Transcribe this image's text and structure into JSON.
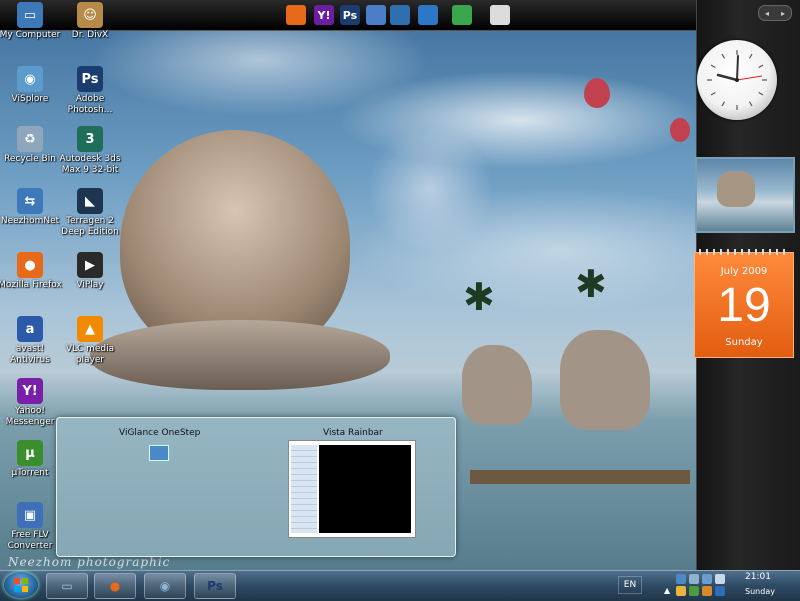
{
  "quick_launch": [
    {
      "name": "firefox-icon",
      "glyph": "",
      "color": "#e66a1a"
    },
    {
      "name": "yahoo-messenger-icon",
      "glyph": "Y!",
      "color": "#6b1fa0"
    },
    {
      "name": "photoshop-icon",
      "glyph": "Ps",
      "color": "#1b3c6e"
    },
    {
      "name": "finder-icon",
      "glyph": "",
      "color": "#4b7dc8"
    },
    {
      "name": "monitor-icon",
      "glyph": "",
      "color": "#2f6fb0"
    },
    {
      "name": "lightning-icon",
      "glyph": "",
      "color": "#2c78c6"
    },
    {
      "name": "recycle-icon",
      "glyph": "",
      "color": "#3aa64b"
    },
    {
      "name": "apple-icon",
      "glyph": "",
      "color": "#dcdcdc"
    }
  ],
  "desktop_icons": [
    {
      "name": "my-computer-icon",
      "label": "My Computer",
      "glyph": "▭",
      "color": "#3d78b8"
    },
    {
      "name": "dr-divx-icon",
      "label": "Dr. DivX",
      "glyph": "☺",
      "color": "#b88a4a"
    },
    {
      "name": "visplore-icon",
      "label": "ViSplore",
      "glyph": "◉",
      "color": "#5c9ccc"
    },
    {
      "name": "adobe-photoshop-icon",
      "label": "Adobe Photosh...",
      "glyph": "Ps",
      "color": "#1b3c6e"
    },
    {
      "name": "recycle-bin-icon",
      "label": "Recycle Bin",
      "glyph": "♻",
      "color": "#8fa7bd"
    },
    {
      "name": "autodesk-3ds-max-icon",
      "label": "Autodesk 3ds Max 9 32-bit",
      "glyph": "3",
      "color": "#1e6e5a"
    },
    {
      "name": "neezhomnet-icon",
      "label": "NeezhomNet",
      "glyph": "⇆",
      "color": "#3d78b8"
    },
    {
      "name": "terragen-icon",
      "label": "Terragen 2 Deep Edition",
      "glyph": "◣",
      "color": "#1d3550"
    },
    {
      "name": "mozilla-firefox-icon",
      "label": "Mozilla Firefox",
      "glyph": "●",
      "color": "#e66a1a"
    },
    {
      "name": "viplay-icon",
      "label": "ViPlay",
      "glyph": "▶",
      "color": "#2a2a2a"
    },
    {
      "name": "avast-antivirus-icon",
      "label": "avast! Antivirus",
      "glyph": "a",
      "color": "#2a5aa8"
    },
    {
      "name": "vlc-media-player-icon",
      "label": "VLC media player",
      "glyph": "▲",
      "color": "#f08a00"
    },
    {
      "name": "yahoo-messenger-desktop-icon",
      "label": "Yahoo! Messenger",
      "glyph": "Y!",
      "color": "#7a1fa8"
    },
    {
      "name": "utorrent-icon",
      "label": "µTorrent",
      "glyph": "µ",
      "color": "#3b8e2c"
    },
    {
      "name": "free-flv-converter-icon",
      "label": "Free FLV Converter",
      "glyph": "▣",
      "color": "#3f6fb8"
    }
  ],
  "sidebar": {
    "nav": {
      "prev": "◂",
      "next": "▸"
    },
    "calendar": {
      "month": "July 2009",
      "day": "19",
      "weekday": "Sunday"
    }
  },
  "glance": {
    "items": [
      {
        "name": "viglance-onestep",
        "label": "ViGlance OneStep"
      },
      {
        "name": "vista-rainbar",
        "label": "Vista Rainbar"
      }
    ]
  },
  "taskbar": {
    "buttons": [
      {
        "name": "taskbar-my-computer-button",
        "glyph": "▭",
        "color": "#9cc3e6"
      },
      {
        "name": "taskbar-firefox-button",
        "glyph": "●",
        "color": "#e66a1a"
      },
      {
        "name": "taskbar-visplore-button",
        "glyph": "◉",
        "color": "#8fb9d6"
      },
      {
        "name": "taskbar-photoshop-button",
        "glyph": "Ps",
        "color": "#1b3c6e"
      }
    ],
    "language": "EN",
    "time": "21:01",
    "day": "Sunday"
  },
  "watermark": "Neezhom photographic"
}
